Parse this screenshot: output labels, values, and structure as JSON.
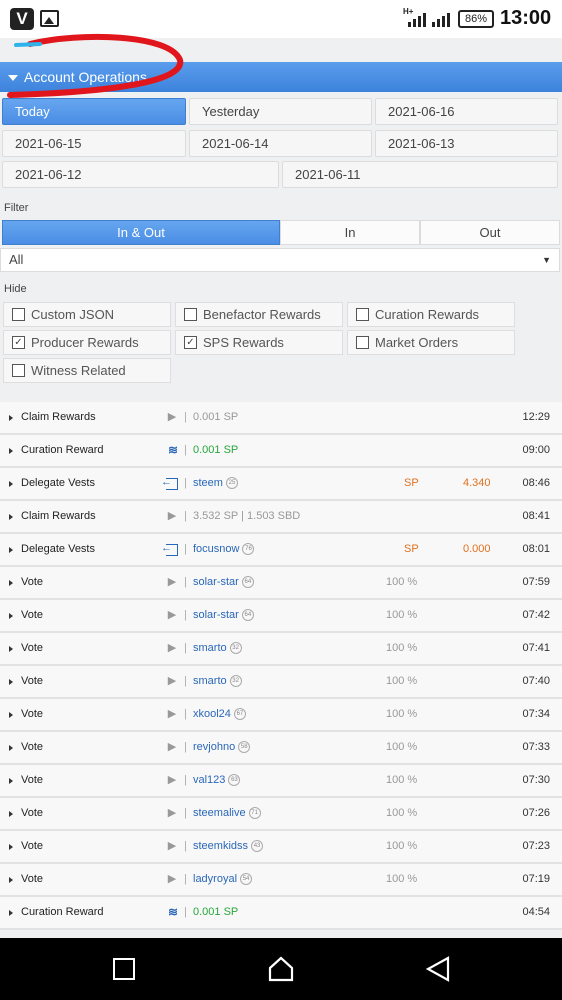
{
  "status": {
    "network": "H+",
    "battery": "86%",
    "time": "13:00"
  },
  "header": {
    "title": "Account Operations"
  },
  "dates": [
    "Today",
    "Yesterday",
    "2021-06-16",
    "2021-06-15",
    "2021-06-14",
    "2021-06-13",
    "2021-06-12",
    "2021-06-11"
  ],
  "filter": {
    "label": "Filter",
    "segments": [
      "In & Out",
      "In",
      "Out"
    ],
    "select_value": "All"
  },
  "hide": {
    "label": "Hide",
    "items": [
      {
        "label": "Custom JSON",
        "checked": false
      },
      {
        "label": "Benefactor Rewards",
        "checked": false
      },
      {
        "label": "Curation Rewards",
        "checked": false
      },
      {
        "label": "Producer Rewards",
        "checked": true
      },
      {
        "label": "SPS Rewards",
        "checked": true
      },
      {
        "label": "Market Orders",
        "checked": false
      },
      {
        "label": "Witness Related",
        "checked": false
      }
    ]
  },
  "ops": [
    {
      "type": "Claim Rewards",
      "icon": "play",
      "detail": "0.001 SP",
      "time": "12:29"
    },
    {
      "type": "Curation Reward",
      "icon": "steem",
      "detail": "0.001 SP",
      "green": true,
      "time": "09:00"
    },
    {
      "type": "Delegate Vests",
      "icon": "delegate",
      "user": "steem",
      "rep": "25",
      "sp": "SP",
      "amount": "4.340",
      "time": "08:46"
    },
    {
      "type": "Claim Rewards",
      "icon": "play",
      "detail": "3.532 SP  |  1.503 SBD",
      "time": "08:41"
    },
    {
      "type": "Delegate Vests",
      "icon": "delegate",
      "user": "focusnow",
      "rep": "76",
      "sp": "SP",
      "amount": "0.000",
      "time": "08:01"
    },
    {
      "type": "Vote",
      "icon": "play",
      "user": "solar-star",
      "rep": "64",
      "pct": "100 %",
      "time": "07:59"
    },
    {
      "type": "Vote",
      "icon": "play",
      "user": "solar-star",
      "rep": "64",
      "pct": "100 %",
      "time": "07:42"
    },
    {
      "type": "Vote",
      "icon": "play",
      "user": "smarto",
      "rep": "32",
      "pct": "100 %",
      "time": "07:41"
    },
    {
      "type": "Vote",
      "icon": "play",
      "user": "smarto",
      "rep": "32",
      "pct": "100 %",
      "time": "07:40"
    },
    {
      "type": "Vote",
      "icon": "play",
      "user": "xkool24",
      "rep": "67",
      "pct": "100 %",
      "time": "07:34"
    },
    {
      "type": "Vote",
      "icon": "play",
      "user": "revjohno",
      "rep": "58",
      "pct": "100 %",
      "time": "07:33"
    },
    {
      "type": "Vote",
      "icon": "play",
      "user": "val123",
      "rep": "63",
      "pct": "100 %",
      "time": "07:30"
    },
    {
      "type": "Vote",
      "icon": "play",
      "user": "steemalive",
      "rep": "71",
      "pct": "100 %",
      "time": "07:26"
    },
    {
      "type": "Vote",
      "icon": "play",
      "user": "steemkidss",
      "rep": "43",
      "pct": "100 %",
      "time": "07:23"
    },
    {
      "type": "Vote",
      "icon": "play",
      "user": "ladyroyal",
      "rep": "54",
      "pct": "100 %",
      "time": "07:19"
    },
    {
      "type": "Curation Reward",
      "icon": "steem",
      "detail": "0.001 SP",
      "green": true,
      "time": "04:54"
    }
  ]
}
